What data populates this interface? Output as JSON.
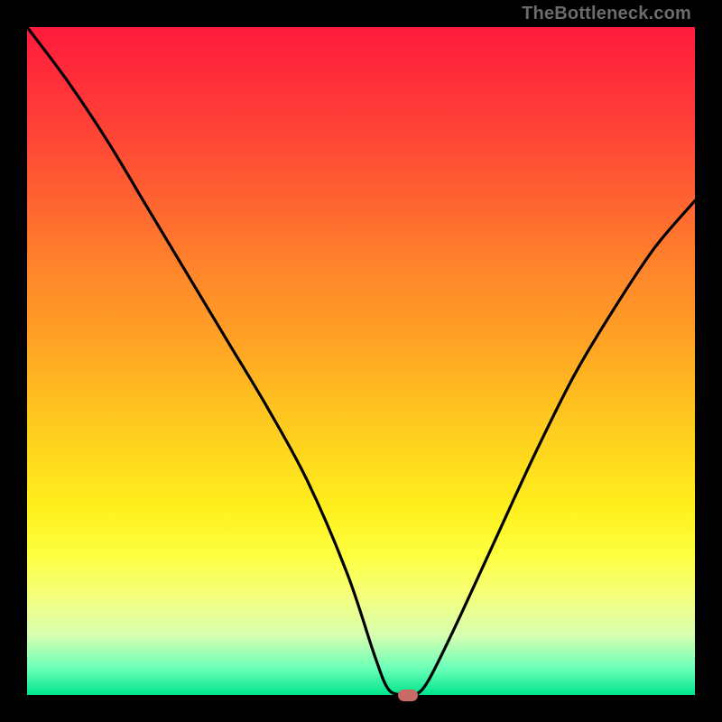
{
  "watermark": {
    "text": "TheBottleneck.com"
  },
  "chart_data": {
    "type": "line",
    "title": "",
    "xlabel": "",
    "ylabel": "",
    "xlim": [
      0,
      100
    ],
    "ylim": [
      0,
      100
    ],
    "grid": false,
    "legend": null,
    "background_gradient_note": "vertical gradient from red (top=100) through orange/yellow to green (bottom=0)",
    "series": [
      {
        "name": "bottleneck-curve",
        "x": [
          0,
          6,
          12,
          18,
          24,
          30,
          36,
          42,
          48,
          52,
          54,
          56,
          58,
          60,
          64,
          70,
          76,
          82,
          88,
          94,
          100
        ],
        "y": [
          100,
          92,
          83,
          73,
          63,
          53,
          43,
          32,
          18,
          6,
          1,
          0,
          0,
          2,
          10,
          23,
          36,
          48,
          58,
          67,
          74
        ]
      }
    ],
    "marker": {
      "x": 57,
      "y": 0,
      "color": "#c96a64",
      "shape": "rounded-rect"
    }
  },
  "colors": {
    "frame": "#000000",
    "watermark": "#6b6b6b",
    "curve": "#000000",
    "marker": "#c96a64"
  }
}
